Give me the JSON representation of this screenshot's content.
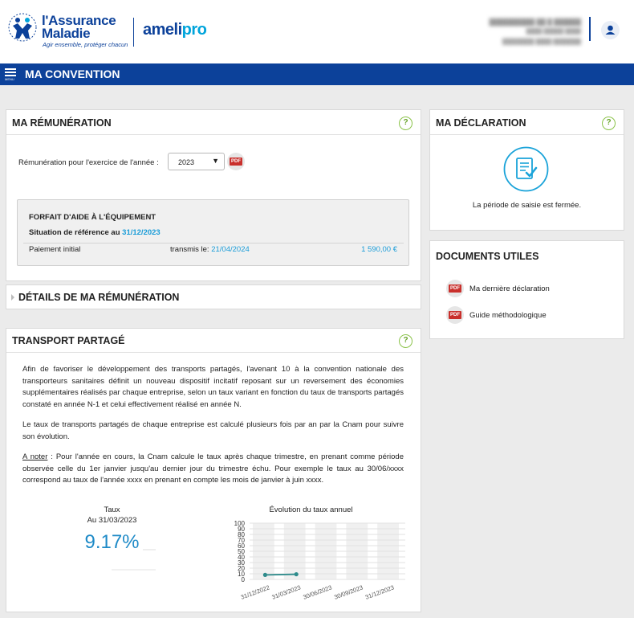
{
  "header": {
    "logo_line1": "l'Assurance",
    "logo_line2": "Maladie",
    "logo_tagline": "Agir ensemble, protéger chacun",
    "product_name": "ameli",
    "product_suffix": "pro",
    "user_icon": "user-icon"
  },
  "nav": {
    "menu_label": "MENU",
    "title": "MA CONVENTION",
    "menu_icon": "hamburger-icon"
  },
  "remuneration": {
    "title": "MA RÉMUNÉRATION",
    "help": "?",
    "year_label": "Rémunération pour l'exercice de l'année :",
    "selected_year": "2023",
    "pdf_label": "PDF",
    "forfait": {
      "title": "FORFAIT D'AIDE À L'ÉQUIPEMENT",
      "reference_label": "Situation de référence au",
      "reference_date": "31/12/2023",
      "payment_label": "Paiement initial",
      "transmis_label": "transmis le:",
      "transmis_date": "21/04/2024",
      "amount": "1 590,00 €"
    }
  },
  "details": {
    "title": "DÉTAILS DE MA RÉMUNÉRATION"
  },
  "transport": {
    "title": "TRANSPORT PARTAGÉ",
    "help": "?",
    "paragraph1": "Afin de favoriser le développement des transports partagés, l'avenant 10 à la convention nationale des transporteurs sanitaires définit un nouveau dispositif incitatif reposant sur un reversement des économies supplémentaires réalisés par chaque entreprise, selon un taux variant en fonction du taux de transports partagés constaté en année N-1 et celui effectivement réalisé en année N.",
    "paragraph2": "Le taux de transports partagés de chaque entreprise est calculé plusieurs fois par an par la Cnam pour suivre son évolution.",
    "note_label": "A noter",
    "paragraph3": " : Pour l'année en cours, la Cnam calcule le taux après chaque trimestre, en prenant comme période observée celle du 1er janvier jusqu'au dernier jour du trimestre échu. Pour exemple le taux au 30/06/xxxx correspond au taux de l'année xxxx en prenant en compte les mois de janvier à juin xxxx.",
    "rate_label": "Taux",
    "rate_date": "Au 31/03/2023",
    "rate_value": "9.17%"
  },
  "declaration": {
    "title": "MA DÉCLARATION",
    "help": "?",
    "icon": "document-check-icon",
    "status": "La période de saisie est fermée."
  },
  "documents": {
    "title": "DOCUMENTS UTILES",
    "items": [
      {
        "label": "Ma dernière déclaration",
        "badge": "PDF"
      },
      {
        "label": "Guide méthodologique",
        "badge": "PDF"
      }
    ]
  },
  "colors": {
    "brand_blue": "#0c419a",
    "accent_blue": "#1a9cd8",
    "help_green": "#8bc34a",
    "pdf_red": "#c9302c",
    "chart_line": "#2e8b8b"
  },
  "chart_data": {
    "type": "line",
    "title": "Évolution du taux annuel",
    "categories": [
      "31/12/2022",
      "31/03/2023",
      "30/06/2023",
      "30/09/2023",
      "31/12/2023"
    ],
    "series": [
      {
        "values": [
          8.0,
          9.17,
          null,
          null,
          null
        ]
      }
    ],
    "y_ticks": [
      0,
      10,
      20,
      30,
      40,
      50,
      60,
      70,
      80,
      90,
      100
    ],
    "ylim": [
      0,
      100
    ],
    "grid": true
  }
}
